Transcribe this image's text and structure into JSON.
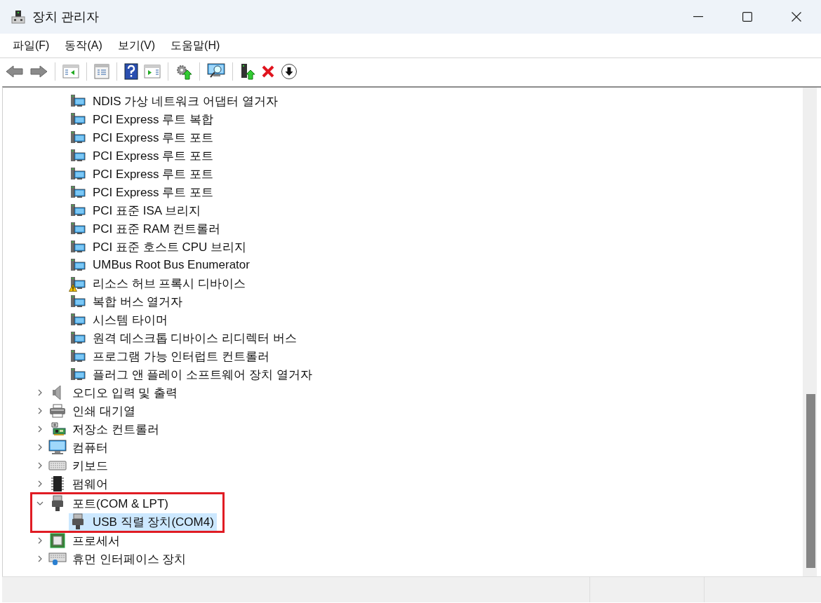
{
  "window": {
    "title": "장치 관리자"
  },
  "menu": [
    "파일(F)",
    "동작(A)",
    "보기(V)",
    "도움말(H)"
  ],
  "tree": {
    "items": [
      {
        "children": [
          {
            "label": "NDIS 가상 네트워크 어댑터 열거자",
            "kind": "system",
            "warning": false,
            "selected": false
          },
          {
            "label": "PCI Express 루트 복합",
            "kind": "system",
            "warning": false,
            "selected": false
          },
          {
            "label": "PCI Express 루트 포트",
            "kind": "system",
            "warning": false,
            "selected": false
          },
          {
            "label": "PCI Express 루트 포트",
            "kind": "system",
            "warning": false,
            "selected": false
          },
          {
            "label": "PCI Express 루트 포트",
            "kind": "system",
            "warning": false,
            "selected": false
          },
          {
            "label": "PCI Express 루트 포트",
            "kind": "system",
            "warning": false,
            "selected": false
          },
          {
            "label": "PCI 표준 ISA 브리지",
            "kind": "system",
            "warning": false,
            "selected": false
          },
          {
            "label": "PCI 표준 RAM 컨트롤러",
            "kind": "system",
            "warning": false,
            "selected": false
          },
          {
            "label": "PCI 표준 호스트 CPU 브리지",
            "kind": "system",
            "warning": false,
            "selected": false
          },
          {
            "label": "UMBus Root Bus Enumerator",
            "kind": "system",
            "warning": false,
            "selected": false
          },
          {
            "label": "리소스 허브 프록시 디바이스",
            "kind": "system",
            "warning": true,
            "selected": false
          },
          {
            "label": "복합 버스 열거자",
            "kind": "system",
            "warning": false,
            "selected": false
          },
          {
            "label": "시스템 타이머",
            "kind": "system",
            "warning": false,
            "selected": false
          },
          {
            "label": "원격 데스크톱 디바이스 리디렉터 버스",
            "kind": "system",
            "warning": false,
            "selected": false
          },
          {
            "label": "프로그램 가능 인터럽트 컨트롤러",
            "kind": "system",
            "warning": false,
            "selected": false
          },
          {
            "label": "플러그 앤 플레이 소프트웨어 장치 열거자",
            "kind": "system",
            "warning": false,
            "selected": false
          }
        ]
      },
      {
        "label": "오디오 입력 및 출력",
        "kind": "audio",
        "expanded": false,
        "highlighted": false,
        "selected": false
      },
      {
        "label": "인쇄 대기열",
        "kind": "printer",
        "expanded": false,
        "highlighted": false,
        "selected": false
      },
      {
        "label": "저장소 컨트롤러",
        "kind": "storage",
        "expanded": false,
        "highlighted": false,
        "selected": false
      },
      {
        "label": "컴퓨터",
        "kind": "computer",
        "expanded": false,
        "highlighted": false,
        "selected": false
      },
      {
        "label": "키보드",
        "kind": "keyboard",
        "expanded": false,
        "highlighted": false,
        "selected": false
      },
      {
        "label": "펌웨어",
        "kind": "firmware",
        "expanded": false,
        "highlighted": false,
        "selected": false
      },
      {
        "label": "포트(COM & LPT)",
        "kind": "port",
        "expanded": true,
        "highlighted": true,
        "selected": false,
        "children": [
          {
            "label": "USB 직렬 장치(COM4)",
            "kind": "port",
            "warning": false,
            "selected": true
          }
        ]
      },
      {
        "label": "프로세서",
        "kind": "processor",
        "expanded": false,
        "highlighted": false,
        "selected": false
      },
      {
        "label": "휴먼 인터페이스 장치",
        "kind": "hid",
        "expanded": false,
        "highlighted": false,
        "selected": false
      }
    ]
  }
}
